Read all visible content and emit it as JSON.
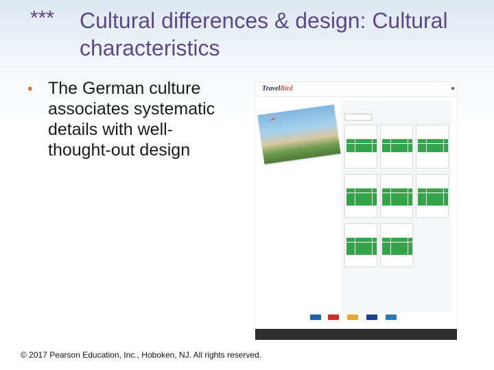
{
  "slide": {
    "title_prefix": "***",
    "title": "Cultural differences & design: Cultural characteristics",
    "bullets": [
      "The German culture associates systematic details with well-thought-out design"
    ],
    "footer": "© 2017 Pearson Education, Inc., Hoboken, NJ.  All rights reserved."
  },
  "screenshot": {
    "logo_main": "Travel",
    "logo_accent": "Bird",
    "colors": {
      "available_green": "#35a34a",
      "brand_orange": "#e0582e",
      "footer_dark": "#2d2d2d",
      "title_purple": "#5a4a86",
      "bullet_orange": "#d9763a"
    },
    "months": [
      {
        "cells": 28
      },
      {
        "cells": 28
      },
      {
        "cells": 28
      },
      {
        "cells": 35
      },
      {
        "cells": 35
      },
      {
        "cells": 35
      },
      {
        "cells": 35
      },
      {
        "cells": 35
      }
    ],
    "payment_icons": [
      "ups-icon",
      "dhl-icon",
      "mastercard-icon",
      "visa-icon",
      "paypal-icon"
    ]
  }
}
